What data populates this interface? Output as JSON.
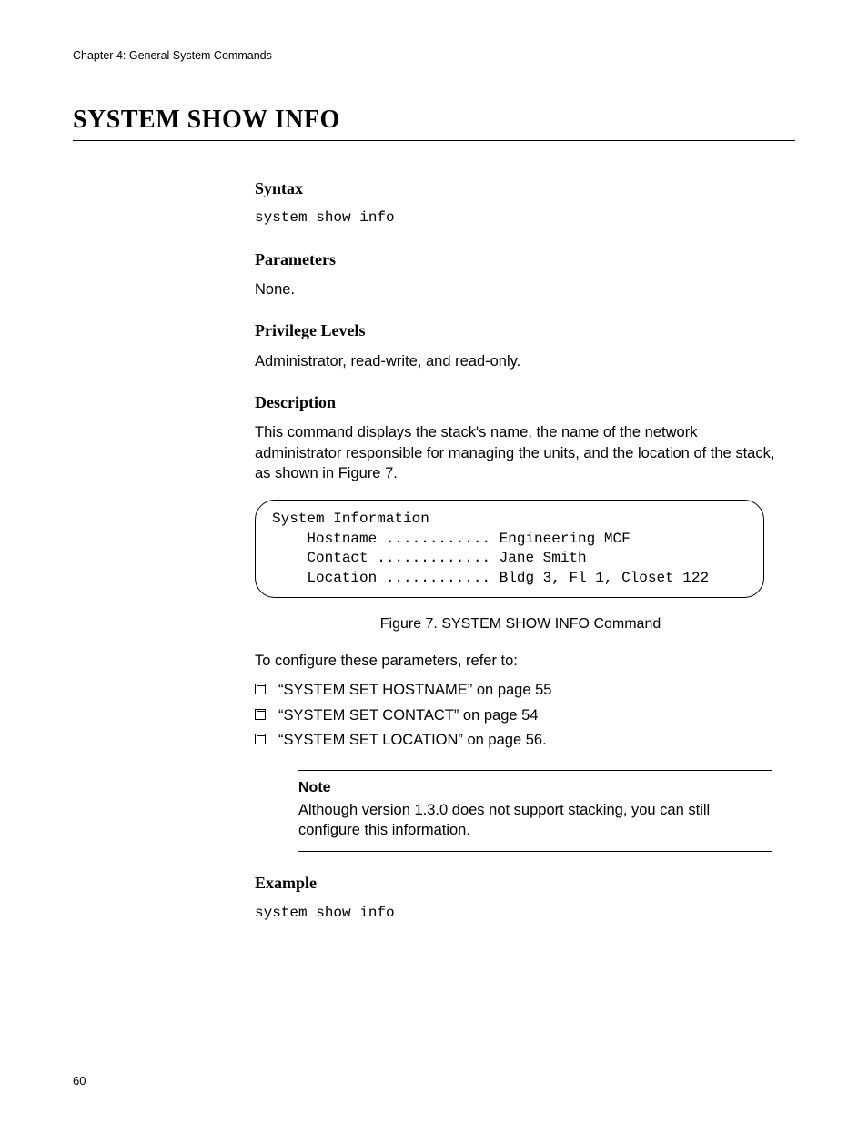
{
  "header": {
    "running_head": "Chapter 4: General System Commands",
    "title": "SYSTEM SHOW INFO"
  },
  "sections": {
    "syntax": {
      "heading": "Syntax",
      "code": "system show info"
    },
    "parameters": {
      "heading": "Parameters",
      "text": "None."
    },
    "privilege": {
      "heading": "Privilege Levels",
      "text": "Administrator, read-write, and read-only."
    },
    "description": {
      "heading": "Description",
      "text": "This command displays the stack's name, the name of the network administrator responsible for managing the units, and the location of the stack, as shown in Figure 7."
    },
    "example": {
      "heading": "Example",
      "code": "system show info"
    }
  },
  "figure": {
    "lines": [
      "System Information",
      "    Hostname ............ Engineering MCF",
      "    Contact ............. Jane Smith",
      "    Location ............ Bldg 3, Fl 1, Closet 122"
    ],
    "caption": "Figure 7. SYSTEM SHOW INFO Command"
  },
  "refer": {
    "lead": "To configure these parameters, refer to:",
    "items": [
      "“SYSTEM SET HOSTNAME” on page 55",
      "“SYSTEM SET CONTACT” on page 54",
      "“SYSTEM SET LOCATION” on page 56."
    ]
  },
  "note": {
    "label": "Note",
    "text": "Although version 1.3.0 does not support stacking, you can still configure this information."
  },
  "page_number": "60"
}
